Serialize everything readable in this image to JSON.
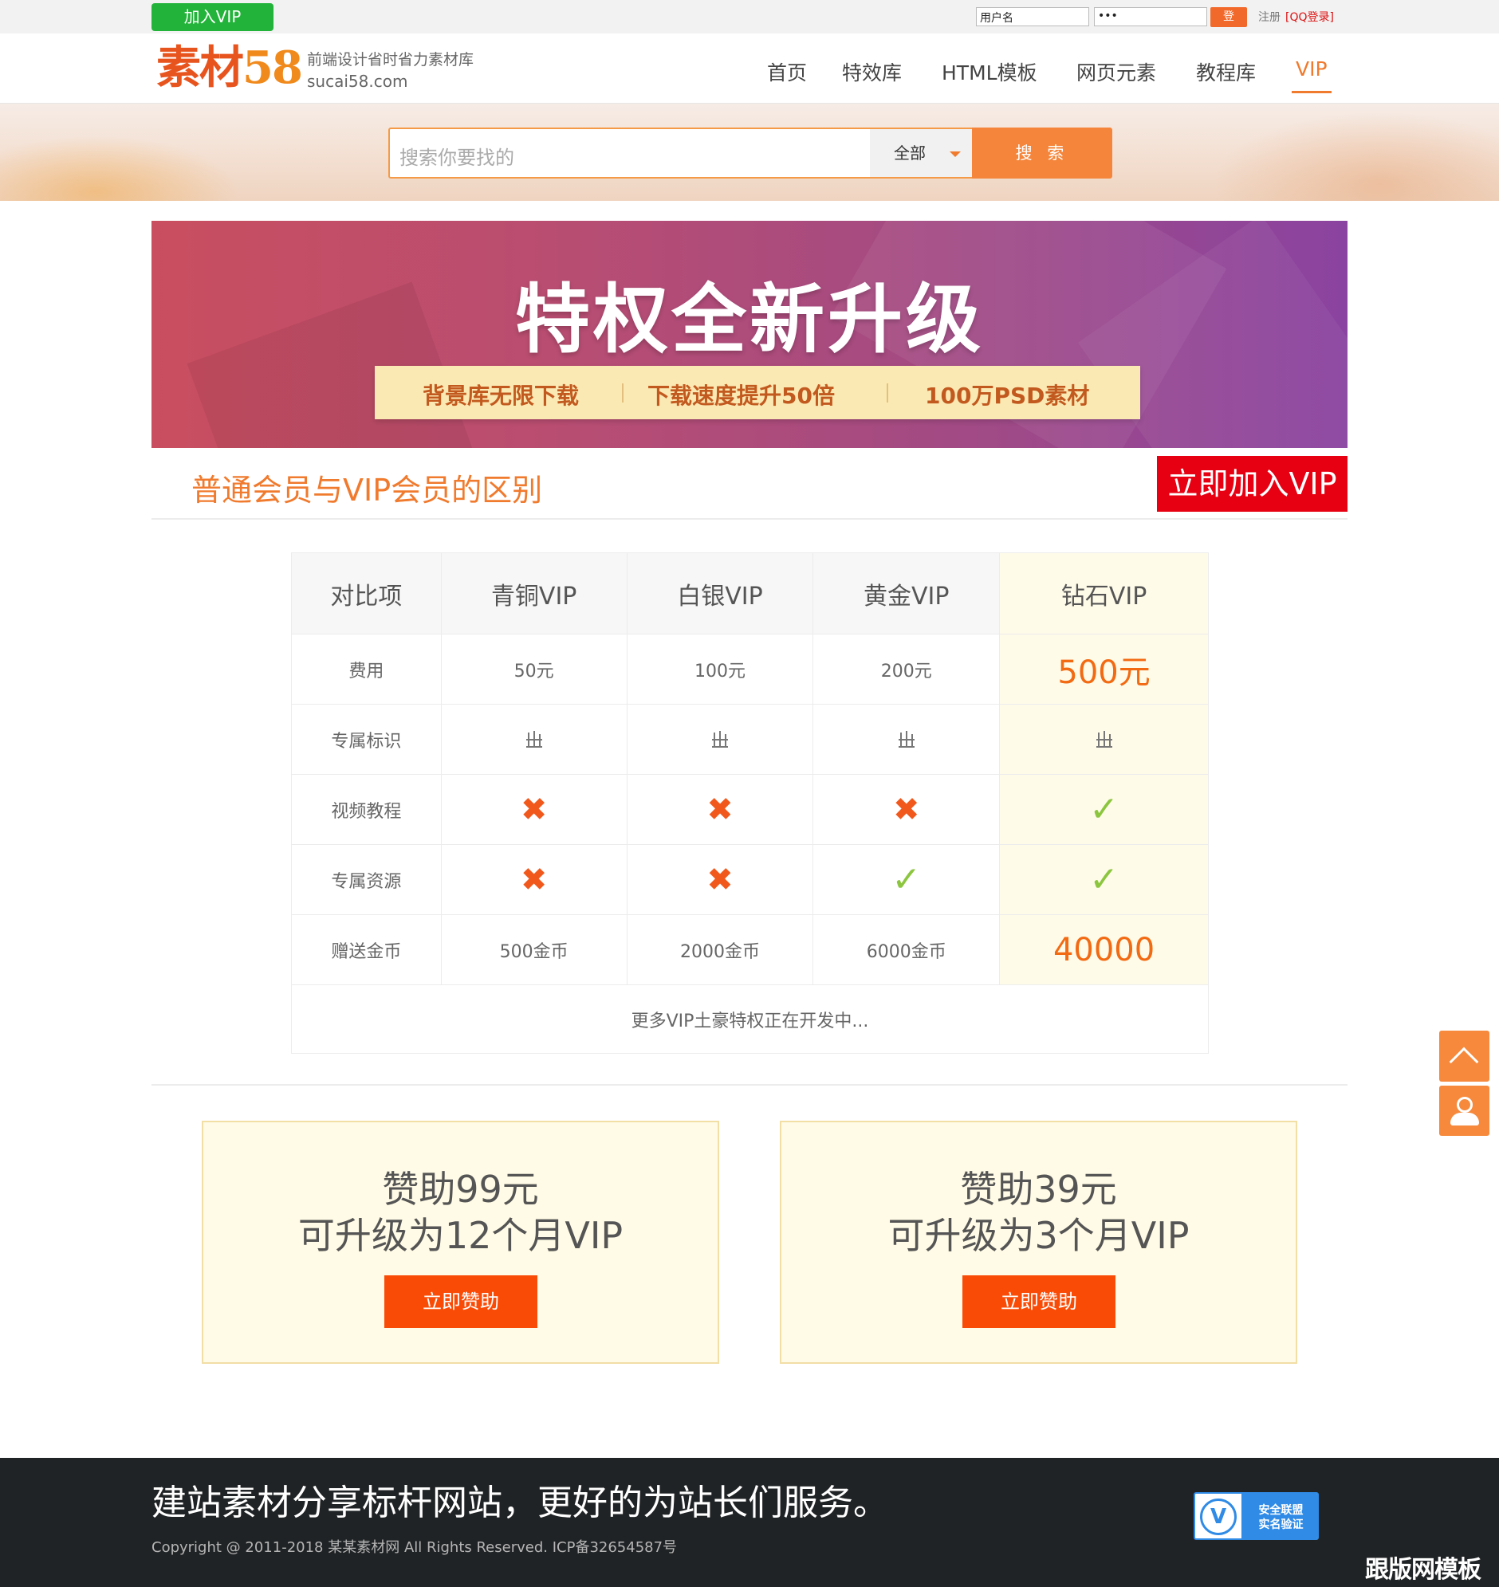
{
  "topbar": {
    "join_vip": "加入VIP",
    "username_value": "用户名",
    "password_value": "•••",
    "login_button": "登",
    "register": "注册",
    "qq_login": "[QQ登录]"
  },
  "header": {
    "logo_text": "素材",
    "logo_num": "58",
    "slogan": "前端设计省时省力素材库",
    "domain": "sucai58.com",
    "nav": [
      {
        "label": "首页",
        "active": false
      },
      {
        "label": "特效库",
        "active": false
      },
      {
        "label": "HTML模板",
        "active": false
      },
      {
        "label": "网页元素",
        "active": false
      },
      {
        "label": "教程库",
        "active": false
      },
      {
        "label": "VIP",
        "active": true
      }
    ]
  },
  "search": {
    "placeholder": "搜索你要找的",
    "category": "全部",
    "button": "搜 索"
  },
  "banner": {
    "title": "特权全新升级",
    "features": [
      "背景库无限下载",
      "下载速度提升50倍",
      "100万PSD素材"
    ]
  },
  "section": {
    "title": "普通会员与VIP会员的区别",
    "join_now": "立即加入VIP"
  },
  "comparison": {
    "headers": [
      "对比项",
      "青铜VIP",
      "白银VIP",
      "黄金VIP",
      "钻石VIP"
    ],
    "rows": [
      {
        "label": "费用",
        "cells": [
          "50元",
          "100元",
          "200元",
          "500元"
        ]
      },
      {
        "label": "专属标识",
        "cells": [
          "badge",
          "badge",
          "badge",
          "badge"
        ]
      },
      {
        "label": "视频教程",
        "cells": [
          "no",
          "no",
          "no",
          "yes"
        ]
      },
      {
        "label": "专属资源",
        "cells": [
          "no",
          "no",
          "yes",
          "yes"
        ]
      },
      {
        "label": "赠送金币",
        "cells": [
          "500金币",
          "2000金币",
          "6000金币",
          "40000"
        ]
      }
    ],
    "footer_note": "更多VIP土豪特权正在开发中..."
  },
  "sponsors": [
    {
      "line1": "赞助99元",
      "line2": "可升级为12个月VIP",
      "button": "立即赞助"
    },
    {
      "line1": "赞助39元",
      "line2": "可升级为3个月VIP",
      "button": "立即赞助"
    }
  ],
  "footer": {
    "slogan": "建站素材分享标杆网站，更好的为站长们服务。",
    "copyright": "Copyright @ 2011-2018 某某素材网 All Rights Reserved. ICP备32654587号",
    "badge_seal": "V",
    "badge_line1": "安全联盟",
    "badge_line2": "实名验证"
  },
  "watermark": "跟版网模板",
  "colors": {
    "accent": "#f07a2d",
    "vip_green": "#22b33a",
    "join_red": "#e60012",
    "sponsor_btn": "#fa4b06",
    "footer_bg": "#202325"
  }
}
